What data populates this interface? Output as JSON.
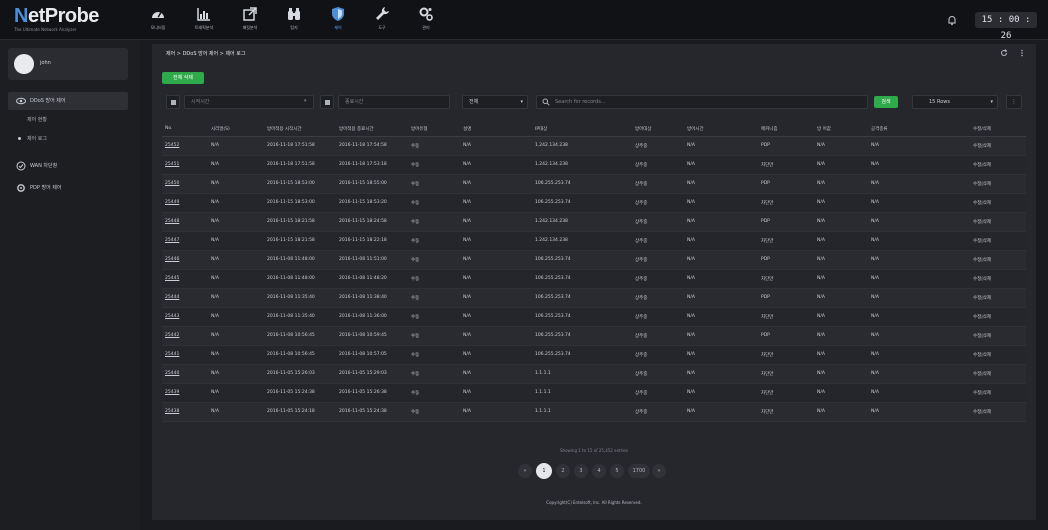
{
  "app": {
    "logo": "NetProbe",
    "logo_first": "N",
    "logo_rest": "etProbe",
    "tagline": "The Ultimate Network Analyzer"
  },
  "nav": [
    {
      "label": "모니터링",
      "icon": "dashboard-icon"
    },
    {
      "label": "트래픽분석",
      "icon": "bar-chart-icon"
    },
    {
      "label": "패킷분석",
      "icon": "external-link-icon"
    },
    {
      "label": "탐지",
      "icon": "binoculars-icon"
    },
    {
      "label": "제어",
      "icon": "shield-icon",
      "active": true
    },
    {
      "label": "도구",
      "icon": "wrench-icon"
    },
    {
      "label": "관리",
      "icon": "gears-icon"
    }
  ],
  "clock": "15 : 00 : 26",
  "sidebar": {
    "username": "john",
    "items": [
      {
        "label": "DDoS 방어 제어",
        "icon": "eye-icon",
        "active": true
      },
      {
        "label": "WAN 차단창",
        "icon": "check-circle-icon"
      },
      {
        "label": "PDP 방어 제어",
        "icon": "gear-icon"
      }
    ],
    "subitems": [
      {
        "label": "제어 현황"
      },
      {
        "label": "제어 로그"
      }
    ]
  },
  "main": {
    "breadcrumb": "제어 > DDoS 방어 제어 > 제어 로그",
    "delete_all_label": "전체 삭제",
    "start_time_placeholder": "시작시간",
    "end_time_placeholder": "종료시간",
    "type_select": "전체",
    "search_placeholder": "Search for records...",
    "search_button": "검색",
    "rows_select": "15 Rows",
    "columns": [
      "No.",
      "시리얼(S)",
      "방어적용 시작시간",
      "방어적용 종료시간",
      "방어유형",
      "설명",
      "IP대상",
      "방어대상",
      "방어시간",
      "매커니즘",
      "방 어값",
      "공격종류",
      "수정/삭제"
    ],
    "rows": [
      [
        "25452",
        "N/A",
        "2016-11-18 17:51:58",
        "2016-11-18 17:54:58",
        "수동",
        "N/A",
        "1.242.134.238",
        "상주중",
        "N/A",
        "PDP",
        "N/A",
        "N/A",
        "수정|삭제"
      ],
      [
        "25451",
        "N/A",
        "2016-11-18 17:51:58",
        "2016-11-18 17:53:18",
        "수동",
        "N/A",
        "1.242.134.238",
        "상주중",
        "N/A",
        "차단만",
        "N/A",
        "N/A",
        "수정|삭제"
      ],
      [
        "25450",
        "N/A",
        "2016-11-15 18:53:00",
        "2016-11-15 18:55:00",
        "수동",
        "N/A",
        "106.255.253.74",
        "상주중",
        "N/A",
        "PDP",
        "N/A",
        "N/A",
        "수정|삭제"
      ],
      [
        "25449",
        "N/A",
        "2016-11-15 18:53:00",
        "2016-11-15 18:53:20",
        "수동",
        "N/A",
        "106.255.253.74",
        "상주중",
        "N/A",
        "차단만",
        "N/A",
        "N/A",
        "수정|삭제"
      ],
      [
        "25448",
        "N/A",
        "2016-11-15 18:21:58",
        "2016-11-15 18:24:58",
        "수동",
        "N/A",
        "1.242.134.238",
        "상주중",
        "N/A",
        "PDP",
        "N/A",
        "N/A",
        "수정|삭제"
      ],
      [
        "25447",
        "N/A",
        "2016-11-15 18:21:58",
        "2016-11-15 18:22:18",
        "수동",
        "N/A",
        "1.242.134.238",
        "상주중",
        "N/A",
        "차단만",
        "N/A",
        "N/A",
        "수정|삭제"
      ],
      [
        "25446",
        "N/A",
        "2016-11-08 11:48:00",
        "2016-11-08 11:51:00",
        "수동",
        "N/A",
        "106.255.253.74",
        "상주중",
        "N/A",
        "PDP",
        "N/A",
        "N/A",
        "수정|삭제"
      ],
      [
        "25445",
        "N/A",
        "2016-11-08 11:48:00",
        "2016-11-08 11:48:20",
        "수동",
        "N/A",
        "106.255.253.74",
        "상주중",
        "N/A",
        "차단만",
        "N/A",
        "N/A",
        "수정|삭제"
      ],
      [
        "25444",
        "N/A",
        "2016-11-08 11:35:40",
        "2016-11-08 11:38:40",
        "수동",
        "N/A",
        "106.255.253.74",
        "상주중",
        "N/A",
        "PDP",
        "N/A",
        "N/A",
        "수정|삭제"
      ],
      [
        "25443",
        "N/A",
        "2016-11-08 11:35:40",
        "2016-11-08 11:36:00",
        "수동",
        "N/A",
        "106.255.253.74",
        "상주중",
        "N/A",
        "차단만",
        "N/A",
        "N/A",
        "수정|삭제"
      ],
      [
        "25442",
        "N/A",
        "2016-11-08 10:56:45",
        "2016-11-08 10:59:45",
        "수동",
        "N/A",
        "106.255.253.74",
        "상주중",
        "N/A",
        "PDP",
        "N/A",
        "N/A",
        "수정|삭제"
      ],
      [
        "25441",
        "N/A",
        "2016-11-08 10:56:45",
        "2016-11-08 10:57:05",
        "수동",
        "N/A",
        "106.255.253.74",
        "상주중",
        "N/A",
        "차단만",
        "N/A",
        "N/A",
        "수정|삭제"
      ],
      [
        "25440",
        "N/A",
        "2016-11-05 15:26:03",
        "2016-11-05 15:29:03",
        "수동",
        "N/A",
        "1.1.1.1",
        "상주중",
        "N/A",
        "차단만",
        "N/A",
        "N/A",
        "수정|삭제"
      ],
      [
        "25439",
        "N/A",
        "2016-11-05 15:24:38",
        "2016-11-05 15:26:38",
        "수동",
        "N/A",
        "1.1.1.1",
        "상주중",
        "N/A",
        "차단만",
        "N/A",
        "N/A",
        "수정|삭제"
      ],
      [
        "25438",
        "N/A",
        "2016-11-05 15:24:18",
        "2016-11-05 15:24:38",
        "수동",
        "N/A",
        "1.1.1.1",
        "상주중",
        "N/A",
        "차단만",
        "N/A",
        "N/A",
        "수정|삭제"
      ]
    ],
    "showing": "Showing 1 to 15 of 25,452 entries",
    "pages": [
      "«",
      "1",
      "2",
      "3",
      "4",
      "5",
      "1700",
      "»"
    ],
    "active_page": "1",
    "footer": "Copyright(C) Entelsoft, Inc. All Rights Reserved."
  },
  "colors": {
    "accent": "#2eaa4a",
    "nav_active": "#5aa2f0",
    "background": "#1a1b1f"
  }
}
